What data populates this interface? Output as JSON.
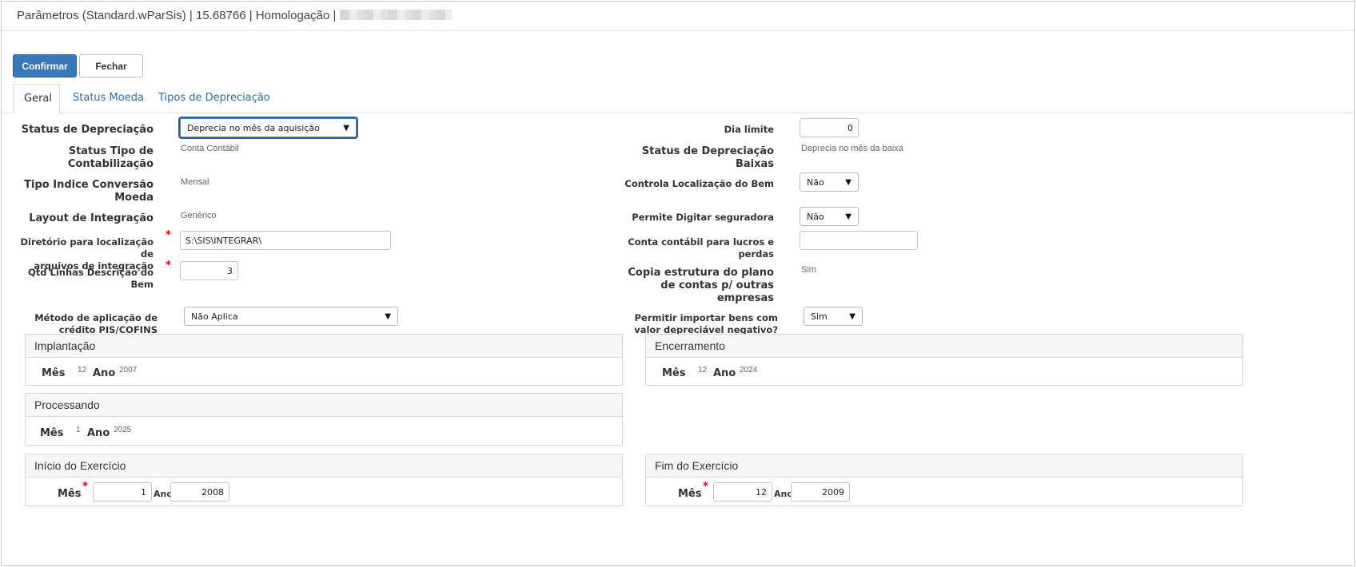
{
  "titlebar": {
    "title": "Parâmetros (Standard.wParSis) | 15.68766 | Homologação |"
  },
  "toolbar": {
    "confirm_label": "Confirmar",
    "close_label": "Fechar"
  },
  "tabs": [
    {
      "label": "Geral"
    },
    {
      "label": "Status Moeda"
    },
    {
      "label": "Tipos de Depreciação"
    }
  ],
  "form_left": {
    "status_depreciacao": {
      "label": "Status de Depreciação",
      "value": "Deprecia no mês da aquisição"
    },
    "status_tipo_contab": {
      "label_l1": "Status Tipo de",
      "label_l2": "Contabilização",
      "value": "Conta Contábil"
    },
    "tipo_indice": {
      "label_l1": "Tipo Indice Conversão",
      "label_l2": "Moeda",
      "value": "Mensal"
    },
    "layout_integracao": {
      "label": "Layout de Integração",
      "value": "Genérico"
    },
    "diretorio": {
      "label_l1": "Diretório para localização de",
      "label_l2": "arquivos de integração",
      "value": "S:\\SIS\\INTEGRAR\\"
    },
    "qtd_linhas": {
      "label": "Qtd Linhas Descrição do Bem",
      "value": "3"
    },
    "metodo_pis": {
      "label_l1": "Método de aplicação de",
      "label_l2": "crédito PIS/COFINS",
      "value": "Não Aplica"
    }
  },
  "form_right": {
    "dia_limite": {
      "label": "Dia limite",
      "value": "0"
    },
    "status_dep_baixas": {
      "label_l1": "Status de Depreciação",
      "label_l2": "Baixas",
      "value": "Deprecia no mês da baixa"
    },
    "controla_localizacao": {
      "label": "Controla Localização do Bem",
      "value": "Não"
    },
    "permite_seguradora": {
      "label": "Permite Digitar seguradora",
      "value": "Não"
    },
    "conta_lucros": {
      "label_l1": "Conta contábil para lucros e",
      "label_l2": "perdas",
      "value": ""
    },
    "copia_estrutura": {
      "label_l1": "Copia estrutura do plano",
      "label_l2": "de contas p/ outras",
      "label_l3": "empresas",
      "value": "Sim"
    },
    "permitir_importar": {
      "label_l1": "Permitir importar bens com",
      "label_l2": "valor depreciável negativo?",
      "value": "Sim"
    }
  },
  "panels": {
    "implantacao": {
      "title": "Implantação",
      "mes_label": "Mês",
      "mes": "12",
      "ano_label": "Ano",
      "ano": "2007"
    },
    "encerramento": {
      "title": "Encerramento",
      "mes_label": "Mês",
      "mes": "12",
      "ano_label": "Ano",
      "ano": "2024"
    },
    "processando": {
      "title": "Processando",
      "mes_label": "Mês",
      "mes": "1",
      "ano_label": "Ano",
      "ano": "2025"
    },
    "inicio_exercicio": {
      "title": "Início do Exercício",
      "mes_label": "Mês",
      "mes": "1",
      "ano_label": "Ano",
      "ano": "2008"
    },
    "fim_exercicio": {
      "title": "Fim do Exercício",
      "mes_label": "Mês",
      "mes": "12",
      "ano_label": "Ano",
      "ano": "2009"
    }
  },
  "required_mark": "*",
  "icons": {
    "dropdown": "chevron-down-icon"
  }
}
